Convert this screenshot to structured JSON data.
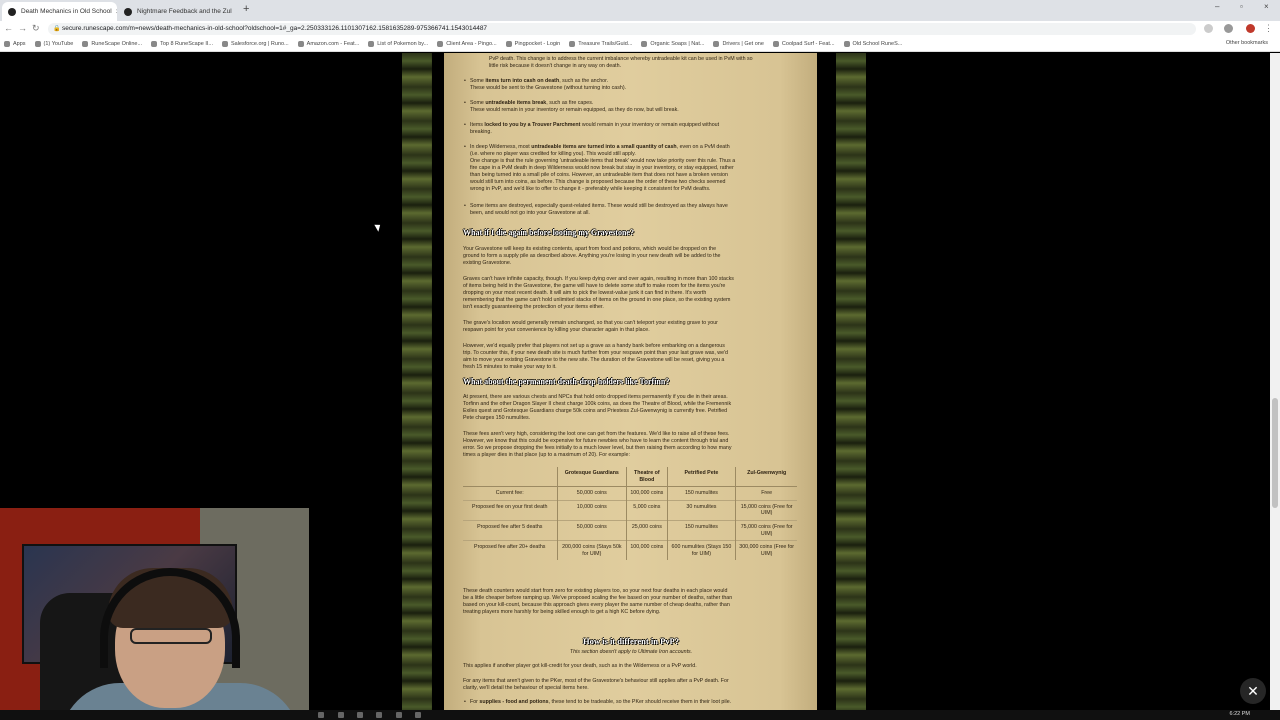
{
  "browser": {
    "tabs": [
      {
        "title": "Death Mechanics in Old School",
        "active": true
      },
      {
        "title": "Nightmare Feedback and the Zul",
        "active": false
      }
    ],
    "url": "secure.runescape.com/m=news/death-mechanics-in-old-school?oldschool=1#_ga=2.250333126.1101307162.1581635289-975366741.1543014487",
    "bookmarks": [
      "Apps",
      "(1) YouTube",
      "RuneScape Online...",
      "Top 8 RuneScape II...",
      "Salesforce.org | Runo...",
      "Amazon.com - Feat...",
      "List of Pokemon by...",
      "Client Area - Pingo...",
      "Pingpocket - Login",
      "Treasure Trails/Guid...",
      "Organic Soaps | Nat...",
      "Drivers | Get one",
      "Coolpad Surf - Feat...",
      "Old School RuneS..."
    ],
    "other_bookmarks": "Other bookmarks"
  },
  "article": {
    "intro_lines": [
      "PvP death. This change is to address the current imbalance whereby untradeable kit can be used in PvM with so",
      "little risk because it doesn't change in any way on death."
    ],
    "bullets_top": [
      {
        "bold": "items turn into cash on death",
        "pre": "Some ",
        "post": ", such as the anchor.",
        "extra": "These would be sent to the Gravestone (without turning into cash)."
      },
      {
        "bold": "untradeable items break",
        "pre": "Some ",
        "post": ", such as fire capes.",
        "extra": "These would remain in your inventory or remain equipped, as they do now, but will break."
      },
      {
        "bold": "locked to you by a Trouver Parchment",
        "pre": "Items ",
        "post": " would remain in your inventory or remain equipped without",
        "extra": "breaking."
      }
    ],
    "wildy_bullet": {
      "pre": "In deep Wilderness, most ",
      "bold": "untradeable items are turned into a small quantity of cash",
      "post": ", even on a PvM death",
      "lines": [
        "(i.e. where no player was credited for killing you). This would still apply.",
        "One change is that the rule governing 'untradeable items that break' would now take priority over this rule. Thus a",
        "fire cape in a PvM death in deep Wilderness would now break but stay in your inventory, or stay equipped, rather",
        "than being turned into a small pile of coins. However, an untradeable item that does not have a broken version",
        "would still turn into coins, as before. This change is proposed because the order of these two checks seemed",
        "wrong in PvP, and we'd like to offer to change it - preferably while keeping it consistent for PvM deaths."
      ]
    },
    "quest_bullet": [
      "Some items are destroyed, especially quest-related items. These would still be destroyed as they always have",
      "been, and would not go into your Gravestone at all."
    ],
    "heading1": "What if I die again before looting my Gravestone?",
    "para1": [
      "Your Gravestone will keep its existing contents, apart from food and potions, which would be dropped on the",
      "ground to form a supply pile as described above. Anything you're losing in your new death will be added to the",
      "existing Gravestone."
    ],
    "para2": [
      "Graves can't have infinite capacity, though. If you keep dying over and over again, resulting in more than 100 stacks",
      "of items being held in the Gravestone, the game will have to delete some stuff to make room for the items you're",
      "dropping on your most recent death. It will aim to pick the lowest-value junk it can find in there. It's worth",
      "remembering that the game can't hold unlimited stacks of items on the ground in one place, so the existing system",
      "isn't exactly guaranteeing the protection of your items either."
    ],
    "para3": [
      "The grave's location would generally remain unchanged, so that you can't teleport your existing grave to your",
      "respawn point for your convenience by killing your character again in that place."
    ],
    "para4": [
      "However, we'd equally prefer that players not set up a grave as a handy bank before embarking on a dangerous",
      "trip. To counter this, if your new death site is much further from your respawn point than your last grave was, we'd",
      "aim to move your existing Gravestone to the new site. The duration of the Gravestone will be reset, giving you a",
      "fresh 15 minutes to make your way to it."
    ],
    "heading2": "What about the permanent death-drop holders like Torfinn?",
    "para5": [
      "At present, there are various chests and NPCs that hold onto dropped items permanently if you die in their areas.",
      "Torfinn and the other Dragon Slayer II chest charge 100k coins, as does the Theatre of Blood, while the Fremennik",
      "Exiles quest and Grotesque Guardians charge 50k coins and Priestess Zul-Gwenwynig is currently free. Petrified",
      "Pete charges 150 numulites."
    ],
    "para6": [
      "These fees aren't very high, considering the loot one can get from the features. We'd like to raise all of these fees.",
      "However, we know that this could be expensive for future newbies who have to learn the content through trial and",
      "error. So we propose dropping the fees initially to a much lower level, but then raising them according to how many",
      "times a player dies in that place (up to a maximum of 20). For example:"
    ],
    "table": {
      "headers": [
        "",
        "Grotesque Guardians",
        "Theatre of Blood",
        "Petrified Pete",
        "Zul-Gwenwynig"
      ],
      "rows": [
        [
          "Current fee:",
          "50,000 coins",
          "100,000 coins",
          "150 numulites",
          "Free"
        ],
        [
          "Proposed fee on your first death",
          "10,000 coins",
          "5,000 coins",
          "30 numulites",
          "15,000 coins (Free for UIM)"
        ],
        [
          "Proposed fee after 5 deaths",
          "50,000 coins",
          "25,000 coins",
          "150 numulites",
          "75,000 coins (Free for UIM)"
        ],
        [
          "Proposed fee after 20+ deaths",
          "200,000 coins (Stays 50k for UIM)",
          "100,000 coins",
          "600 numulites (Stays 150 for UIM)",
          "300,000 coins (Free for UIM)"
        ]
      ]
    },
    "para7": [
      "These death counters would start from zero for existing players too, so your next four deaths in each place would",
      "be a little cheaper before ramping up. We've proposed scaling the fee based on your number of deaths, rather than",
      "based on your kill-count, because this approach gives every player the same number of cheap deaths, rather than",
      "treating players more harshly for being skilled enough to get a high KC before dying."
    ],
    "heading3": "How is it different in PvP?",
    "subheading3": "This section doesn't apply to Ultimate Iron accounts.",
    "para8": "This applies if another player got kill-credit for your death, such as in the Wilderness or a PvP world.",
    "para9": [
      "For any items that aren't given to the PKer, most of the Gravestone's behaviour still applies after a PvP death. For",
      "clarity, we'll detail the behaviour of special items here."
    ],
    "last_bullet": {
      "pre": "For ",
      "bold": "supplies - food and potions",
      "post": ", these tend to be tradeable, so the PKer should receive them in their loot pile."
    }
  },
  "taskbar": {
    "time": "6:22 PM"
  }
}
